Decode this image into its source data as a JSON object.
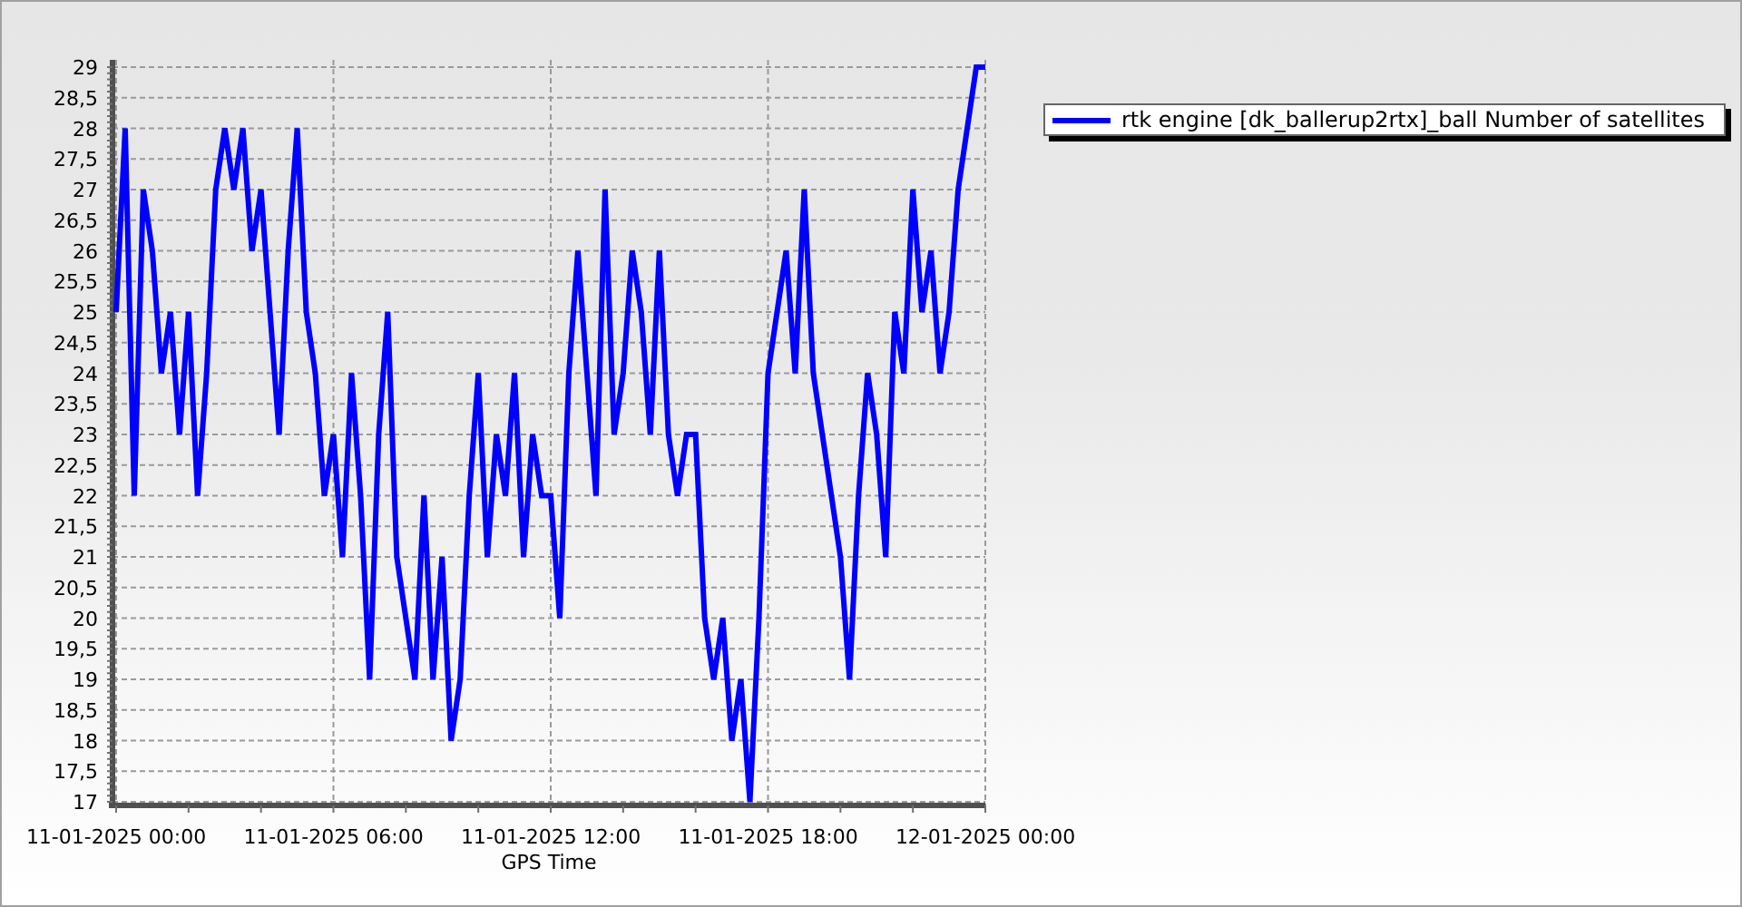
{
  "chart_data": {
    "type": "line",
    "grid": true,
    "xlabel": "GPS Time",
    "categories": [
      "11-01-2025 00:00",
      null,
      null,
      null,
      null,
      null,
      null,
      null,
      null,
      null,
      null,
      null,
      null,
      null,
      null,
      null,
      null,
      null,
      null,
      null,
      null,
      null,
      null,
      null,
      "11-01-2025 06:00",
      null,
      null,
      null,
      null,
      null,
      null,
      null,
      null,
      null,
      null,
      null,
      null,
      null,
      null,
      null,
      null,
      null,
      null,
      null,
      null,
      null,
      null,
      null,
      "11-01-2025 12:00",
      null,
      null,
      null,
      null,
      null,
      null,
      null,
      null,
      null,
      null,
      null,
      null,
      null,
      null,
      null,
      null,
      null,
      null,
      null,
      null,
      null,
      null,
      null,
      "11-01-2025 18:00",
      null,
      null,
      null,
      null,
      null,
      null,
      null,
      null,
      null,
      null,
      null,
      null,
      null,
      null,
      null,
      null,
      null,
      null,
      null,
      null,
      null,
      null,
      null,
      "12-01-2025 00:00"
    ],
    "series": [
      {
        "name": "rtk engine [dk_ballerup2rtx]_ball Number of satellites",
        "color": "#0000ff",
        "values": [
          25,
          28,
          22,
          27,
          26,
          24,
          25,
          23,
          25,
          22,
          24,
          27,
          28,
          27,
          28,
          26,
          27,
          25,
          23,
          26,
          28,
          25,
          24,
          22,
          23,
          21,
          24,
          22,
          19,
          23,
          25,
          21,
          20,
          19,
          22,
          19,
          21,
          18,
          19,
          22,
          24,
          21,
          23,
          22,
          24,
          21,
          23,
          22,
          22,
          20,
          24,
          26,
          24,
          22,
          27,
          23,
          24,
          26,
          25,
          23,
          26,
          23,
          22,
          23,
          23,
          20,
          19,
          20,
          18,
          19,
          17,
          20,
          24,
          25,
          26,
          24,
          27,
          24,
          23,
          22,
          21,
          19,
          22,
          24,
          23,
          21,
          25,
          24,
          27,
          25,
          26,
          24,
          25,
          27,
          28,
          29,
          29
        ]
      }
    ],
    "ylim": [
      17,
      29
    ],
    "yticks": [
      {
        "value": 17,
        "label": "17"
      },
      {
        "value": 17.5,
        "label": "17,5"
      },
      {
        "value": 18,
        "label": "18"
      },
      {
        "value": 18.5,
        "label": "18,5"
      },
      {
        "value": 19,
        "label": "19"
      },
      {
        "value": 19.5,
        "label": "19,5"
      },
      {
        "value": 20,
        "label": "20"
      },
      {
        "value": 20.5,
        "label": "20,5"
      },
      {
        "value": 21,
        "label": "21"
      },
      {
        "value": 21.5,
        "label": "21,5"
      },
      {
        "value": 22,
        "label": "22"
      },
      {
        "value": 22.5,
        "label": "22,5"
      },
      {
        "value": 23,
        "label": "23"
      },
      {
        "value": 23.5,
        "label": "23,5"
      },
      {
        "value": 24,
        "label": "24"
      },
      {
        "value": 24.5,
        "label": "24,5"
      },
      {
        "value": 25,
        "label": "25"
      },
      {
        "value": 25.5,
        "label": "25,5"
      },
      {
        "value": 26,
        "label": "26"
      },
      {
        "value": 26.5,
        "label": "26,5"
      },
      {
        "value": 27,
        "label": "27"
      },
      {
        "value": 27.5,
        "label": "27,5"
      },
      {
        "value": 28,
        "label": "28"
      },
      {
        "value": 28.5,
        "label": "28,5"
      },
      {
        "value": 29,
        "label": "29"
      }
    ]
  }
}
